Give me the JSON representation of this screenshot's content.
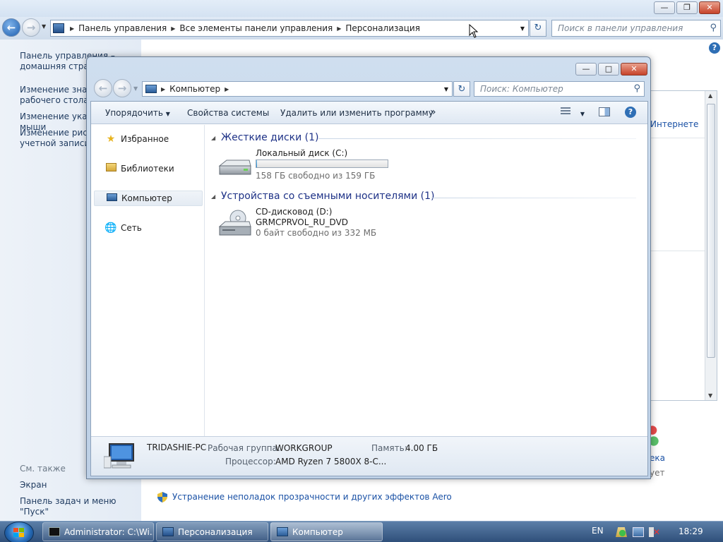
{
  "background_window": {
    "address": [
      "Панель управления",
      "Все элементы панели управления",
      "Персонализация"
    ],
    "search_placeholder": "Поиск в панели управления",
    "left_links": [
      "Панель управления – домашняя страница",
      "Изменение значков рабочего стола",
      "Изменение указателей мыши",
      "Изменение рисунка учетной записи"
    ],
    "see_also_title": "См. также",
    "see_also": [
      "Экран",
      "Панель задач и меню \"Пуск\""
    ],
    "aero_link": "Устранение неполадок прозрачности и других эффектов Aero",
    "right_fragments": [
      "Интернете",
      "ека",
      "ует"
    ]
  },
  "explorer": {
    "address": [
      "Компьютер"
    ],
    "search_placeholder": "Поиск: Компьютер",
    "toolbar": {
      "organize": "Упорядочить",
      "system_properties": "Свойства системы",
      "uninstall": "Удалить или изменить программу",
      "more": "»"
    },
    "sidebar": [
      {
        "label": "Избранное",
        "icon": "star-icon"
      },
      {
        "label": "Библиотеки",
        "icon": "library-icon"
      },
      {
        "label": "Компьютер",
        "icon": "computer-icon"
      },
      {
        "label": "Сеть",
        "icon": "network-icon"
      }
    ],
    "groups": {
      "hdd_title": "Жесткие диски (1)",
      "removable_title": "Устройства со съемными носителями (1)"
    },
    "drives": {
      "c_name": "Локальный диск (C:)",
      "c_free": "158 ГБ свободно из 159 ГБ",
      "c_used_fraction": 0.006,
      "d_name": "CD-дисковод (D:)",
      "d_label": "GRMCPRVOL_RU_DVD",
      "d_free": "0 байт свободно из 332 МБ"
    },
    "details": {
      "computer_name": "TRIDASHIE-PC",
      "workgroup_label": "Рабочая группа:",
      "workgroup_value": "WORKGROUP",
      "memory_label": "Память:",
      "memory_value": "4.00 ГБ",
      "cpu_label": "Процессор:",
      "cpu_value": "AMD Ryzen 7 5800X 8-C..."
    }
  },
  "taskbar": {
    "buttons": [
      "Administrator: C:\\Wi...",
      "Персонализация",
      "Компьютер"
    ],
    "language": "EN",
    "time": "18:29"
  },
  "colors": {
    "link": "#1a51a5",
    "group_heading": "#1e3287",
    "capacity_fill": "#2c8ed4"
  }
}
